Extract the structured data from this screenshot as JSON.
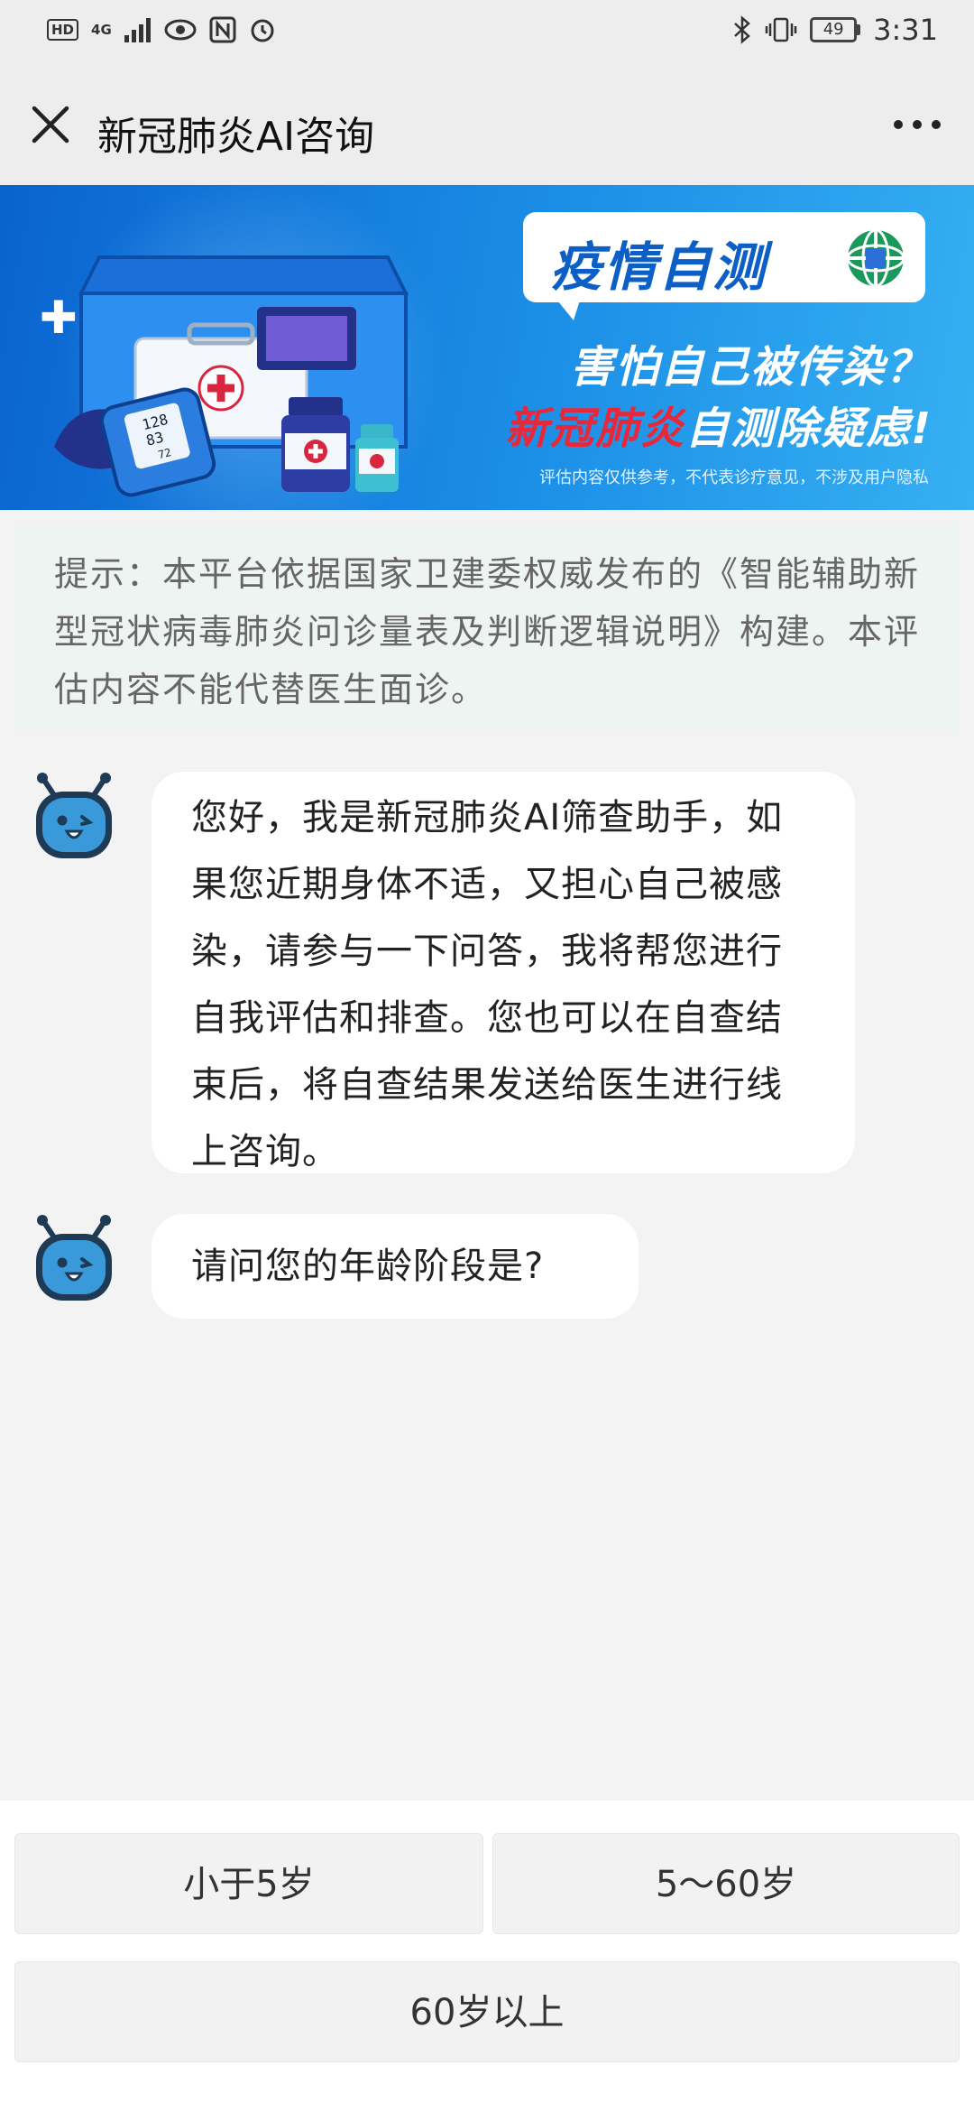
{
  "status_bar": {
    "left_icons": [
      "hd-icon",
      "signal-4g-icon",
      "eye-icon",
      "nfc-icon",
      "alarm-icon"
    ],
    "hd_label": "HD",
    "net_label": "4G",
    "battery": "49",
    "time": "3:31"
  },
  "header": {
    "title": "新冠肺炎AI咨询"
  },
  "banner": {
    "tag_text": "疫情自测",
    "line1": "害怕自己被传染？",
    "line2_red": "新冠肺炎",
    "line2_white": "自测除疑虑!",
    "note": "评估内容仅供参考，不代表诊疗意见，不涉及用户隐私",
    "monitor_readings": [
      "128",
      "83",
      "72"
    ]
  },
  "tip": {
    "text": "提示：本平台依据国家卫建委权威发布的《智能辅助新型冠状病毒肺炎问诊量表及判断逻辑说明》构建。本评估内容不能代替医生面诊。"
  },
  "messages": [
    {
      "text": "您好，我是新冠肺炎AI筛查助手，如果您近期身体不适，又担心自己被感染，请参与一下问答，我将帮您进行自我评估和排查。您也可以在自查结束后，将自查结果发送给医生进行线上咨询。"
    },
    {
      "text": "请问您的年龄阶段是?"
    }
  ],
  "options": {
    "under5": "小于5岁",
    "five_to_sixty": "5～60岁",
    "over60": "60岁以上"
  },
  "colors": {
    "banner_blue": "#0a63cf",
    "banner_red": "#e8283a",
    "bot_blue": "#3a9ad9"
  }
}
